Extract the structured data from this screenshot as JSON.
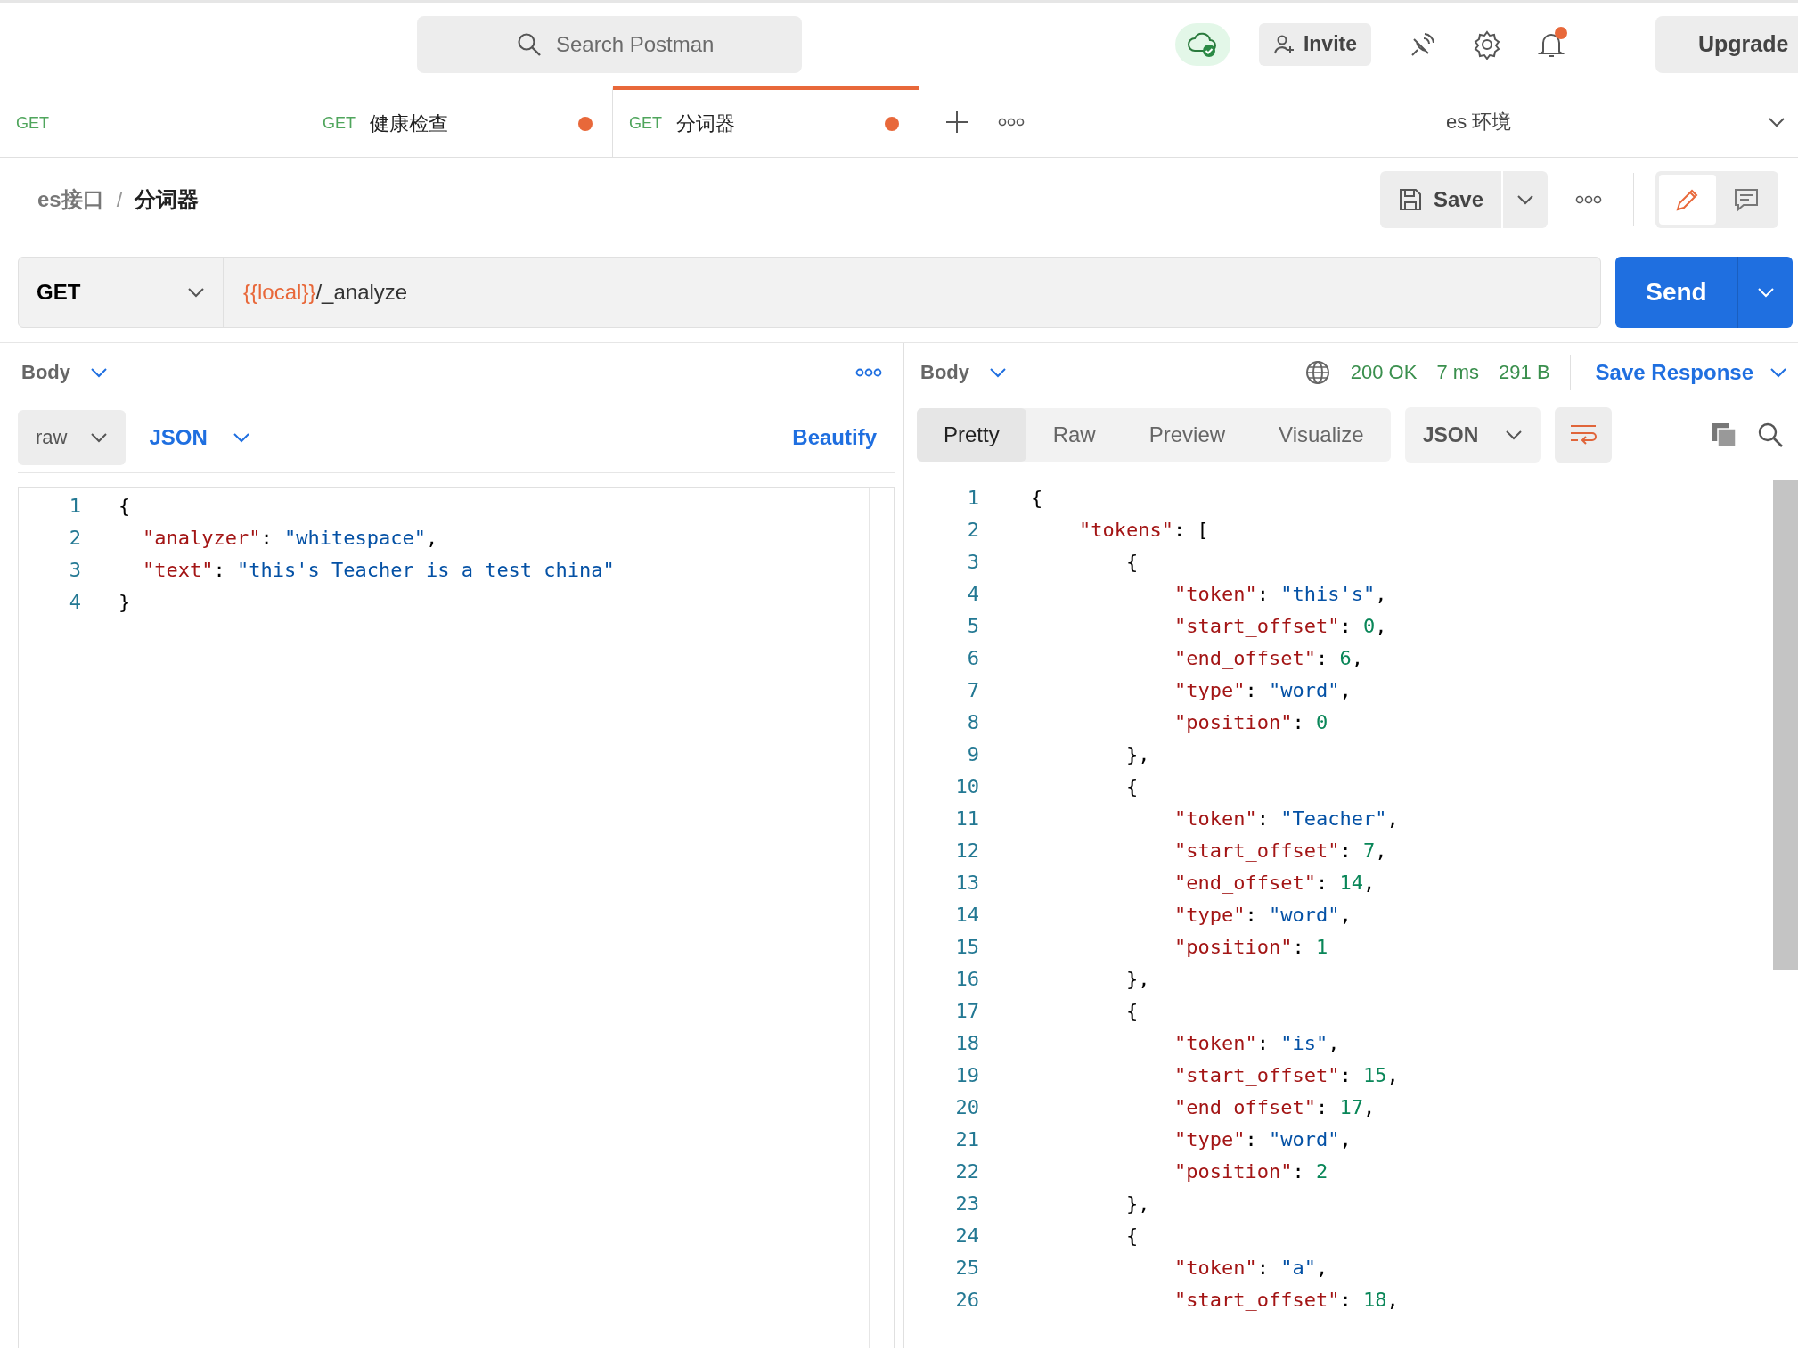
{
  "header": {
    "search": {
      "placeholder": "Search Postman"
    },
    "invite": "Invite",
    "upgrade": "Upgrade",
    "notification_dot": true
  },
  "tabs": [
    {
      "method": "GET",
      "unsaved": false,
      "selected": false
    },
    {
      "method": "GET",
      "title": "健康检查",
      "unsaved": true,
      "selected": false
    },
    {
      "method": "GET",
      "title": "分词器",
      "unsaved": true,
      "selected": true
    }
  ],
  "environment": "es 环境",
  "breadcrumb": {
    "collection": "es接口",
    "separator": "/",
    "request": "分词器"
  },
  "save_button": "Save",
  "request": {
    "method": "GET",
    "url_variable": "{{local}}",
    "url_path": "/_analyze",
    "send": "Send"
  },
  "request_body": {
    "section": "Body",
    "mode": "raw",
    "language": "JSON",
    "beautify": "Beautify",
    "lines": [
      {
        "number": "1",
        "kind": "root",
        "segments": [
          {
            "kind": "punct",
            "text": "{"
          }
        ]
      },
      {
        "number": "2",
        "kind": "member",
        "segments": [
          {
            "kind": "key",
            "text": "\"analyzer\""
          },
          {
            "kind": "punct",
            "text": ": "
          },
          {
            "kind": "str",
            "text": "\"whitespace\""
          },
          {
            "kind": "punct",
            "text": ","
          }
        ]
      },
      {
        "number": "3",
        "kind": "member",
        "segments": [
          {
            "kind": "key",
            "text": "\"text\""
          },
          {
            "kind": "punct",
            "text": ": "
          },
          {
            "kind": "str",
            "text": "\"this's Teacher is a test china\""
          }
        ]
      },
      {
        "number": "4",
        "kind": "root",
        "segments": [
          {
            "kind": "punct",
            "text": "}"
          }
        ]
      }
    ]
  },
  "response": {
    "section": "Body",
    "status": "200 OK",
    "time": "7 ms",
    "size": "291 B",
    "save_response": "Save Response",
    "views": [
      {
        "label": "Pretty",
        "selected": true
      },
      {
        "label": "Raw",
        "selected": false
      },
      {
        "label": "Preview",
        "selected": false
      },
      {
        "label": "Visualize",
        "selected": false
      }
    ],
    "language": "JSON",
    "lines": [
      {
        "number": "1",
        "kind": "root",
        "segments": [
          {
            "kind": "punct",
            "text": "{"
          }
        ]
      },
      {
        "number": "2",
        "kind": "member",
        "segments": [
          {
            "kind": "key",
            "text": "\"tokens\""
          },
          {
            "kind": "punct",
            "text": ": ["
          }
        ]
      },
      {
        "number": "3",
        "kind": "object",
        "segments": [
          {
            "kind": "punct",
            "text": "{"
          }
        ]
      },
      {
        "number": "4",
        "kind": "field",
        "segments": [
          {
            "kind": "key",
            "text": "\"token\""
          },
          {
            "kind": "punct",
            "text": ": "
          },
          {
            "kind": "str",
            "text": "\"this's\""
          },
          {
            "kind": "punct",
            "text": ","
          }
        ]
      },
      {
        "number": "5",
        "kind": "field",
        "segments": [
          {
            "kind": "key",
            "text": "\"start_offset\""
          },
          {
            "kind": "punct",
            "text": ": "
          },
          {
            "kind": "num",
            "text": "0"
          },
          {
            "kind": "punct",
            "text": ","
          }
        ]
      },
      {
        "number": "6",
        "kind": "field",
        "segments": [
          {
            "kind": "key",
            "text": "\"end_offset\""
          },
          {
            "kind": "punct",
            "text": ": "
          },
          {
            "kind": "num",
            "text": "6"
          },
          {
            "kind": "punct",
            "text": ","
          }
        ]
      },
      {
        "number": "7",
        "kind": "field",
        "segments": [
          {
            "kind": "key",
            "text": "\"type\""
          },
          {
            "kind": "punct",
            "text": ": "
          },
          {
            "kind": "str",
            "text": "\"word\""
          },
          {
            "kind": "punct",
            "text": ","
          }
        ]
      },
      {
        "number": "8",
        "kind": "field",
        "segments": [
          {
            "kind": "key",
            "text": "\"position\""
          },
          {
            "kind": "punct",
            "text": ": "
          },
          {
            "kind": "num",
            "text": "0"
          }
        ]
      },
      {
        "number": "9",
        "kind": "object",
        "segments": [
          {
            "kind": "punct",
            "text": "},"
          }
        ]
      },
      {
        "number": "10",
        "kind": "object",
        "segments": [
          {
            "kind": "punct",
            "text": "{"
          }
        ]
      },
      {
        "number": "11",
        "kind": "field",
        "segments": [
          {
            "kind": "key",
            "text": "\"token\""
          },
          {
            "kind": "punct",
            "text": ": "
          },
          {
            "kind": "str",
            "text": "\"Teacher\""
          },
          {
            "kind": "punct",
            "text": ","
          }
        ]
      },
      {
        "number": "12",
        "kind": "field",
        "segments": [
          {
            "kind": "key",
            "text": "\"start_offset\""
          },
          {
            "kind": "punct",
            "text": ": "
          },
          {
            "kind": "num",
            "text": "7"
          },
          {
            "kind": "punct",
            "text": ","
          }
        ]
      },
      {
        "number": "13",
        "kind": "field",
        "segments": [
          {
            "kind": "key",
            "text": "\"end_offset\""
          },
          {
            "kind": "punct",
            "text": ": "
          },
          {
            "kind": "num",
            "text": "14"
          },
          {
            "kind": "punct",
            "text": ","
          }
        ]
      },
      {
        "number": "14",
        "kind": "field",
        "segments": [
          {
            "kind": "key",
            "text": "\"type\""
          },
          {
            "kind": "punct",
            "text": ": "
          },
          {
            "kind": "str",
            "text": "\"word\""
          },
          {
            "kind": "punct",
            "text": ","
          }
        ]
      },
      {
        "number": "15",
        "kind": "field",
        "segments": [
          {
            "kind": "key",
            "text": "\"position\""
          },
          {
            "kind": "punct",
            "text": ": "
          },
          {
            "kind": "num",
            "text": "1"
          }
        ]
      },
      {
        "number": "16",
        "kind": "object",
        "segments": [
          {
            "kind": "punct",
            "text": "},"
          }
        ]
      },
      {
        "number": "17",
        "kind": "object",
        "segments": [
          {
            "kind": "punct",
            "text": "{"
          }
        ]
      },
      {
        "number": "18",
        "kind": "field",
        "segments": [
          {
            "kind": "key",
            "text": "\"token\""
          },
          {
            "kind": "punct",
            "text": ": "
          },
          {
            "kind": "str",
            "text": "\"is\""
          },
          {
            "kind": "punct",
            "text": ","
          }
        ]
      },
      {
        "number": "19",
        "kind": "field",
        "segments": [
          {
            "kind": "key",
            "text": "\"start_offset\""
          },
          {
            "kind": "punct",
            "text": ": "
          },
          {
            "kind": "num",
            "text": "15"
          },
          {
            "kind": "punct",
            "text": ","
          }
        ]
      },
      {
        "number": "20",
        "kind": "field",
        "segments": [
          {
            "kind": "key",
            "text": "\"end_offset\""
          },
          {
            "kind": "punct",
            "text": ": "
          },
          {
            "kind": "num",
            "text": "17"
          },
          {
            "kind": "punct",
            "text": ","
          }
        ]
      },
      {
        "number": "21",
        "kind": "field",
        "segments": [
          {
            "kind": "key",
            "text": "\"type\""
          },
          {
            "kind": "punct",
            "text": ": "
          },
          {
            "kind": "str",
            "text": "\"word\""
          },
          {
            "kind": "punct",
            "text": ","
          }
        ]
      },
      {
        "number": "22",
        "kind": "field",
        "segments": [
          {
            "kind": "key",
            "text": "\"position\""
          },
          {
            "kind": "punct",
            "text": ": "
          },
          {
            "kind": "num",
            "text": "2"
          }
        ]
      },
      {
        "number": "23",
        "kind": "object",
        "segments": [
          {
            "kind": "punct",
            "text": "},"
          }
        ]
      },
      {
        "number": "24",
        "kind": "object",
        "segments": [
          {
            "kind": "punct",
            "text": "{"
          }
        ]
      },
      {
        "number": "25",
        "kind": "field",
        "segments": [
          {
            "kind": "key",
            "text": "\"token\""
          },
          {
            "kind": "punct",
            "text": ": "
          },
          {
            "kind": "str",
            "text": "\"a\""
          },
          {
            "kind": "punct",
            "text": ","
          }
        ]
      },
      {
        "number": "26",
        "kind": "field",
        "segments": [
          {
            "kind": "key",
            "text": "\"start_offset\""
          },
          {
            "kind": "punct",
            "text": ": "
          },
          {
            "kind": "num",
            "text": "18"
          },
          {
            "kind": "punct",
            "text": ","
          }
        ]
      }
    ]
  }
}
